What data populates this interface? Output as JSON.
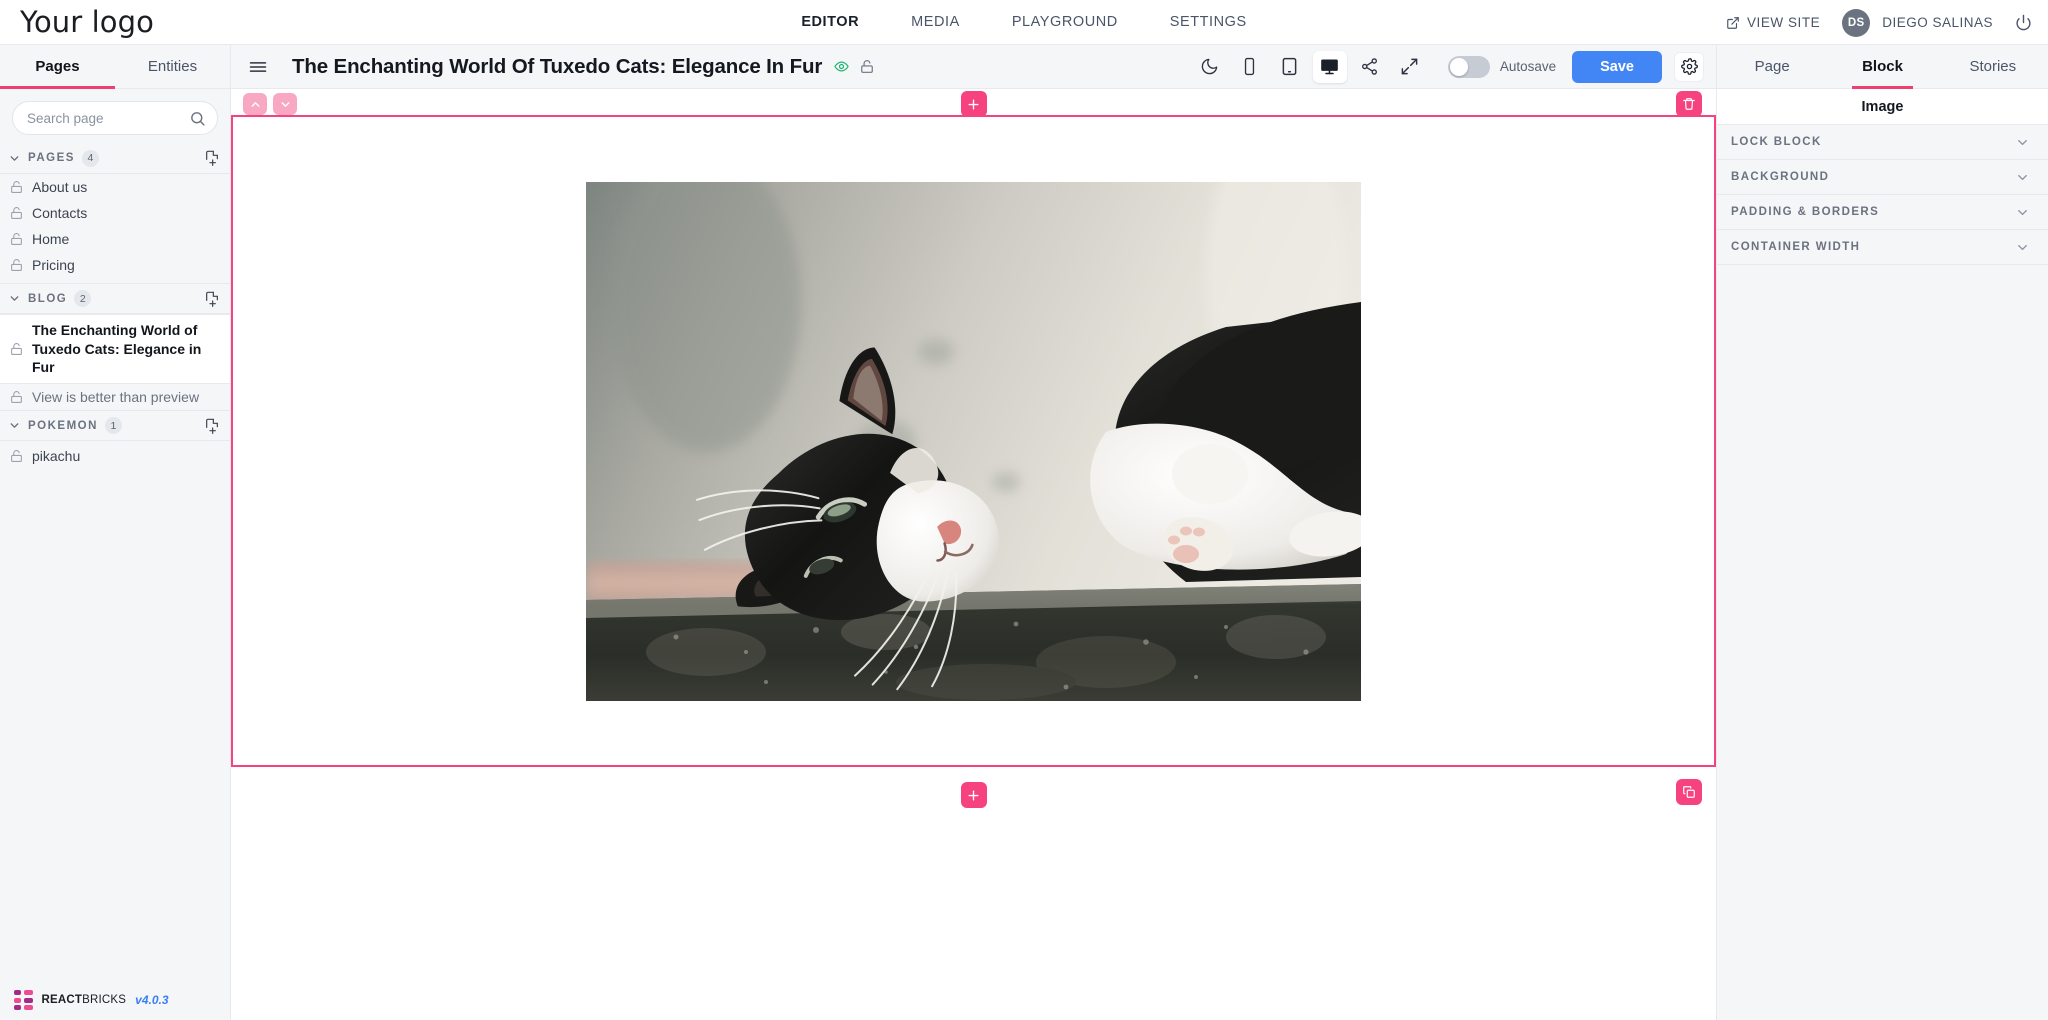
{
  "topbar": {
    "logo": "Your logo",
    "nav": [
      {
        "label": "EDITOR",
        "active": true
      },
      {
        "label": "MEDIA",
        "active": false
      },
      {
        "label": "PLAYGROUND",
        "active": false
      },
      {
        "label": "SETTINGS",
        "active": false
      }
    ],
    "view_site": "VIEW SITE",
    "avatar_initials": "DS",
    "username": "DIEGO SALINAS",
    "icons": {
      "external_link": "external-link-icon",
      "power": "power-icon"
    }
  },
  "sidebar": {
    "tabs": [
      {
        "label": "Pages",
        "active": true
      },
      {
        "label": "Entities",
        "active": false
      }
    ],
    "search": {
      "placeholder": "Search page",
      "value": ""
    },
    "groups": [
      {
        "name": "PAGES",
        "count": "4",
        "items": [
          {
            "label": "About us",
            "selected": false
          },
          {
            "label": "Contacts",
            "selected": false
          },
          {
            "label": "Home",
            "selected": false
          },
          {
            "label": "Pricing",
            "selected": false
          }
        ]
      },
      {
        "name": "BLOG",
        "count": "2",
        "items": [
          {
            "label": "The Enchanting World of Tuxedo Cats: Elegance in Fur",
            "selected": true
          },
          {
            "label": "View is better than preview",
            "selected": false
          }
        ]
      },
      {
        "name": "POKEMON",
        "count": "1",
        "items": [
          {
            "label": "pikachu",
            "selected": false
          }
        ]
      }
    ],
    "brand": {
      "name_bold": "REACT",
      "name_light": "BRICKS",
      "version": "v4.0.3"
    }
  },
  "editor_header": {
    "title": "The Enchanting World Of Tuxedo Cats: Elegance In Fur",
    "autosave_label": "Autosave",
    "autosave_on": false,
    "save_label": "Save",
    "devices": [
      {
        "name": "dark-mode-icon",
        "active": false
      },
      {
        "name": "mobile-icon",
        "active": false
      },
      {
        "name": "tablet-icon",
        "active": false
      },
      {
        "name": "desktop-icon",
        "active": true
      },
      {
        "name": "share-icon",
        "active": false
      },
      {
        "name": "fullscreen-icon",
        "active": false
      }
    ]
  },
  "right_panel": {
    "tabs": [
      {
        "label": "Page",
        "active": false
      },
      {
        "label": "Block",
        "active": true
      },
      {
        "label": "Stories",
        "active": false
      }
    ],
    "block_name": "Image",
    "sections": [
      {
        "label": "LOCK BLOCK"
      },
      {
        "label": "BACKGROUND"
      },
      {
        "label": "PADDING & BORDERS"
      },
      {
        "label": "CONTAINER WIDTH"
      }
    ]
  },
  "canvas": {
    "block_selected": true,
    "image_alt": "Tuxedo cat lying on a stone ledge",
    "buttons": {
      "move_up": "move-up-button",
      "move_down": "move-down-button",
      "add_above": "add-block-above-button",
      "delete": "delete-block-button",
      "add_below": "add-block-below-button",
      "duplicate": "duplicate-block-button"
    }
  },
  "colors": {
    "accent_pink": "#f6437f",
    "accent_pink_pale": "#f9a8c4",
    "tab_underline": "#ed3f72",
    "save_blue": "#4285f4",
    "panel_bg": "#f5f6f8",
    "border": "#e7e9ed"
  }
}
